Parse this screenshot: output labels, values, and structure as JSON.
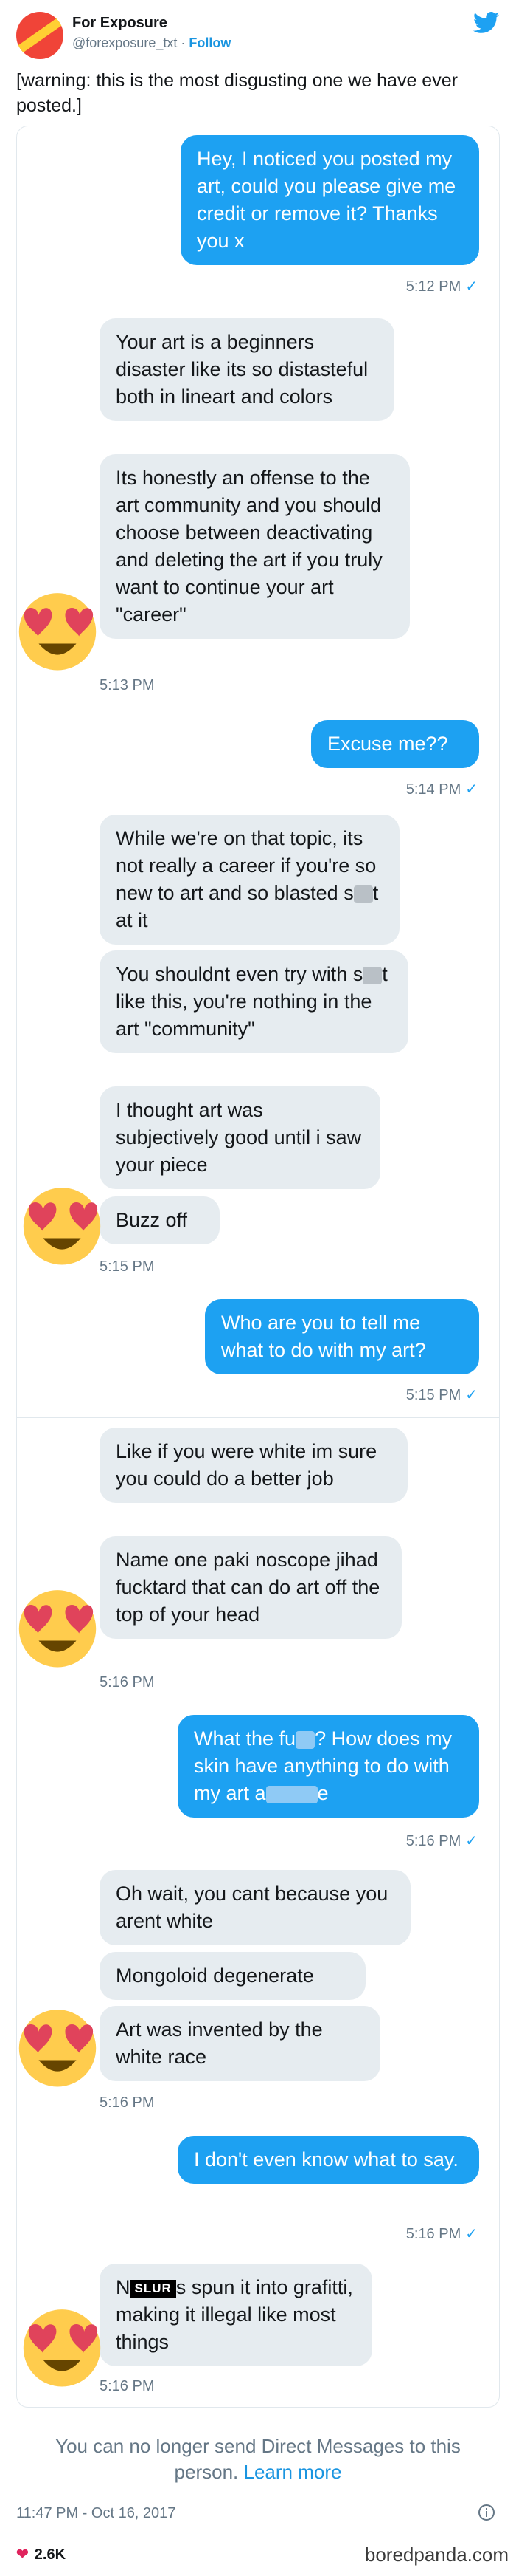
{
  "tweet": {
    "author_name": "For Exposure",
    "author_handle": "@forexposure_txt",
    "follow_label": "Follow",
    "separator": " · ",
    "text": "[warning: this is the most disgusting one we have ever posted.]",
    "meta": "11:47 PM - Oct 16, 2017",
    "likes": "2.6K"
  },
  "colors": {
    "outgoing_bubble": "#1da1f2",
    "incoming_bubble": "#e6ecf0",
    "link": "#1b95e0",
    "avatar": "#f04438"
  },
  "icons": [
    "avatar-logo-icon",
    "twitter-bird-icon",
    "heart-eyes-emoji-icon",
    "check-icon",
    "info-icon",
    "heart-icon"
  ],
  "messages": {
    "m1": "Hey, I noticed you posted my art, could you please give me credit or remove it? Thanks you x",
    "t1": "5:12 PM",
    "m2": "Your art is a beginners disaster like its so distasteful both in lineart and colors",
    "m3": "Its honestly an offense to the art community and you should choose between deactivating and deleting the art if you truly want to continue your art \"career\"",
    "t2": "5:13 PM",
    "m4": "Excuse me??",
    "t3": "5:14 PM",
    "m5a": "While we're on that topic, its not really a career if you're so new to art and so blasted s",
    "m5b": "t at it",
    "m6a": "You shouldnt even try with s",
    "m6b": "t like this, you're nothing in the art \"community\"",
    "m7": "I thought art was subjectively good until i saw your piece",
    "m8": "Buzz off",
    "t4": "5:15 PM",
    "m9": "Who are you to tell me what to do with my art?",
    "t5": "5:15 PM",
    "m10": "Like if you were white im sure you could do a better job",
    "m11": "Name one paki noscope jihad fucktard that can do art off the top of your head",
    "t6": "5:16 PM",
    "m12a": "What the fu",
    "m12b": "? How does my skin have anything to do with my art a",
    "m12c": "e",
    "t7": "5:16 PM",
    "m13": "Oh wait, you cant because you arent white",
    "m14": "Mongoloid degenerate",
    "m15": "Art was invented by the white race",
    "t8": "5:16 PM",
    "m16": "I don't even know what to say.",
    "t9": "5:16 PM",
    "m17a": "N",
    "m17slur": "SLUR",
    "m17b": "s spun it into grafitti, making it illegal like most things",
    "t10": "5:16 PM"
  },
  "notice": {
    "text": "You can no longer send Direct Messages to this person. ",
    "link": "Learn more"
  },
  "watermark": "boredpanda.com"
}
